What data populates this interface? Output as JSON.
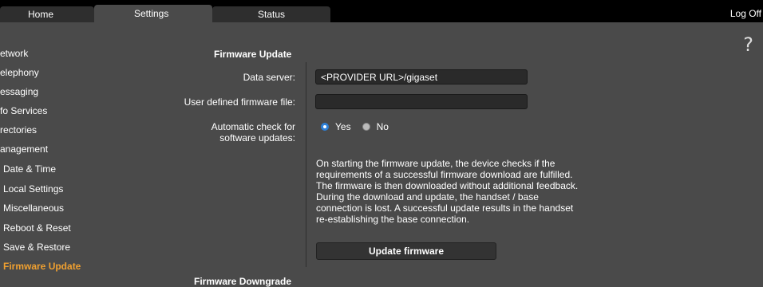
{
  "tabs": {
    "home": "Home",
    "settings": "Settings",
    "status": "Status"
  },
  "logoff": "Log Off",
  "sidebar": {
    "items": [
      {
        "label": "etwork"
      },
      {
        "label": "elephony"
      },
      {
        "label": "essaging"
      },
      {
        "label": "fo Services"
      },
      {
        "label": "rectories"
      },
      {
        "label": "anagement"
      },
      {
        "label": "Date & Time"
      },
      {
        "label": "Local Settings"
      },
      {
        "label": "Miscellaneous"
      },
      {
        "label": "Reboot & Reset"
      },
      {
        "label": "Save & Restore"
      },
      {
        "label": "Firmware Update"
      }
    ]
  },
  "content": {
    "section_title": "Firmware Update",
    "data_server_label": "Data server:",
    "data_server_value": "<PROVIDER URL>/gigaset",
    "user_fw_label": "User defined firmware file:",
    "user_fw_value": "",
    "auto_check_label_1": "Automatic check for",
    "auto_check_label_2": "software updates:",
    "radio_yes": "Yes",
    "radio_no": "No",
    "auto_check_selected": "Yes",
    "description_lines": [
      "On starting the firmware update, the device checks if the",
      "requirements of a successful firmware download are fulfilled.",
      "The firmware is then downloaded without additional feedback.",
      "During the download and update, the handset / base",
      "connection is lost. A successful update results in the handset",
      "re-establishing the base connection."
    ],
    "update_button": "Update firmware",
    "downgrade_title": "Firmware Downgrade"
  },
  "help": "?",
  "colors": {
    "active_menu": "#f0a030",
    "panel_bg": "#4a4a4a",
    "radio_accent": "#2d7fd6"
  }
}
